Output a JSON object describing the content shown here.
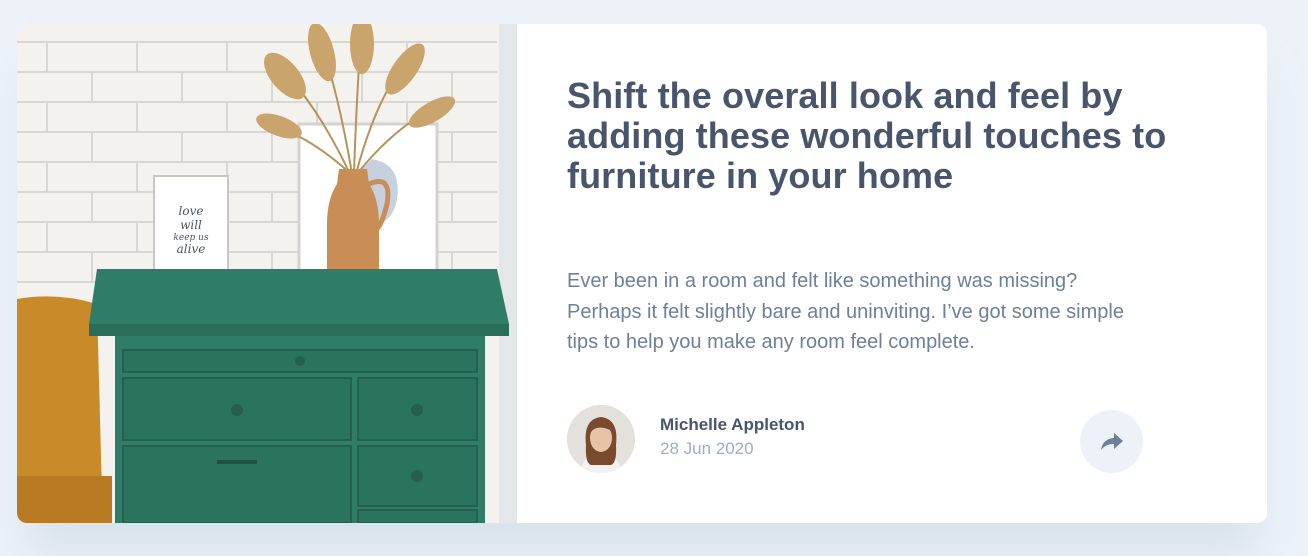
{
  "article": {
    "title": "Shift the overall look and feel by adding these wonderful touches to furniture in your home",
    "description": "Ever been in a room and felt like something was missing? Perhaps it felt slightly bare and uninviting. I’ve got some simple tips to help you make any room feel complete.",
    "image_icon": "drawers-photo",
    "frame_text": [
      "love",
      "will",
      "keep us",
      "alive"
    ]
  },
  "author": {
    "name": "Michelle Appleton",
    "date": "28 Jun 2020",
    "avatar_icon": "avatar-portrait"
  },
  "share": {
    "icon": "share-arrow-icon"
  },
  "colors": {
    "page_background": "#ecf2f8",
    "card_background": "#ffffff",
    "title": "#48556a",
    "body_text": "#6e8098",
    "muted": "#9eafc2",
    "share_button_background": "#ecf2f8",
    "share_icon": "#6e8098",
    "dresser_green": "#2f7d68"
  }
}
